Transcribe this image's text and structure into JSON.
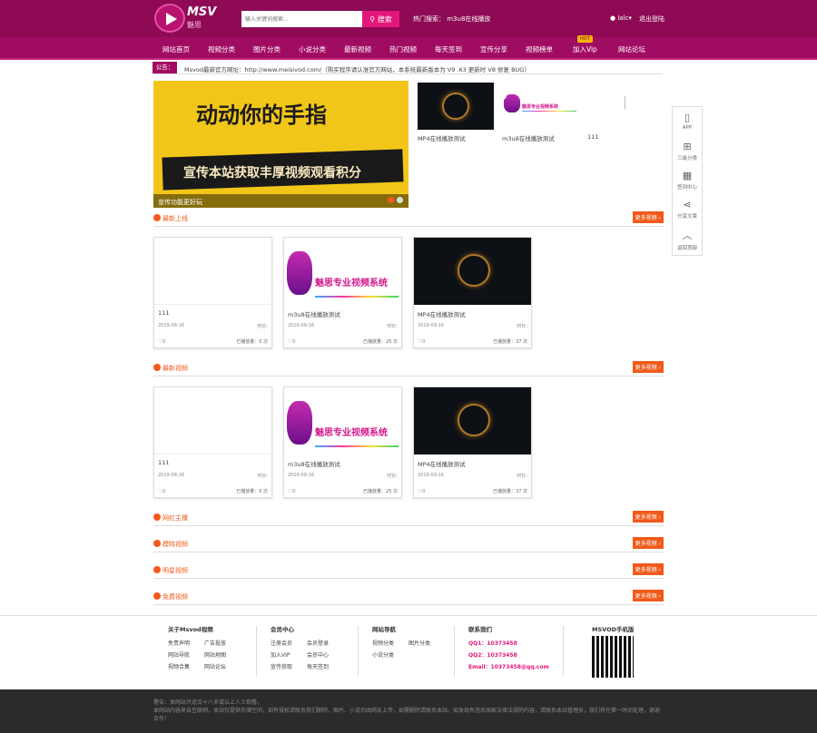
{
  "header": {
    "logo_text": "MSV",
    "logo_sub": "魅思",
    "search_placeholder": "输入关键词搜索...",
    "search_button": "搜索",
    "hot_label": "热门搜索：",
    "hot_words": "m3u8在线播放",
    "user": "lalc",
    "logout": "退出登陆"
  },
  "nav": [
    "网站首页",
    "视频分类",
    "图片分类",
    "小说分类",
    "最新视频",
    "热门视频",
    "每天签到",
    "宣传分享",
    "视频榜单",
    "加入Vip",
    "网站论坛"
  ],
  "nav_badge": "HOT",
  "notice": {
    "label": "公告：",
    "text": "Msvod最新官方网址：http://www.meisivod.com/（购买程序请认准官方网站，本系统最新版本为 V9 .63 更新时 V8 修复 BUG）"
  },
  "banner": {
    "title": "动动你的手指",
    "slogan": "宣传本站获取丰厚视频观看积分",
    "caption": "宣传功能更好玩"
  },
  "top_videos": [
    {
      "title": "MP4在线播放测试"
    },
    {
      "title": "m3u8在线播放测试"
    },
    {
      "title": "111"
    }
  ],
  "promo_text": "魅思专业视频系统",
  "sidebar": [
    "APP",
    "三级分类",
    "签到中心",
    "分享文章",
    "返回顶部"
  ],
  "sections": [
    {
      "name": "最新上线"
    },
    {
      "name": "最新视频"
    },
    {
      "name": "网红主播"
    },
    {
      "name": "模特视频"
    },
    {
      "name": "明星视频"
    },
    {
      "name": "免费视频"
    }
  ],
  "more": "更多视频",
  "cards": [
    {
      "title": "111",
      "date": "2019-08-16",
      "length": "时长:",
      "likes": "0",
      "plays": "已播放量：0 次"
    },
    {
      "title": "m3u8在线播放测试",
      "date": "2019-09-16",
      "length": "时长:",
      "likes": "0",
      "plays": "已播放量：25 次"
    },
    {
      "title": "MP4在线播放测试",
      "date": "2019-09-16",
      "length": "时长:",
      "likes": "0",
      "plays": "已播放量：37 次"
    }
  ],
  "footer": {
    "about": {
      "title": "关于Msvod视频",
      "links": [
        [
          "免责声明",
          "广告投放"
        ],
        [
          "网站导航",
          "网站地图"
        ],
        [
          "视频合集",
          "网站论坛"
        ]
      ]
    },
    "member": {
      "title": "会员中心",
      "links": [
        [
          "注册会员",
          "会员登录"
        ],
        [
          "加入VIP",
          "会员中心"
        ],
        [
          "宣传获取",
          "每天签到"
        ]
      ]
    },
    "site": {
      "title": "网站导航",
      "links": [
        [
          "视频分类",
          "图片分类"
        ],
        [
          "小说分类",
          ""
        ]
      ]
    },
    "contact": {
      "title": "联系我们",
      "qq1": "QQ1：10373458",
      "qq2": "QQ2：10373458",
      "email": "Email：10373458@qq.com"
    },
    "mobile": {
      "title": "MSVOD手机版"
    }
  },
  "bottom": {
    "line1": "警告：本网站只适合十八岁或以上人士观看。",
    "line2": "本网站内容来自互联网，本站仅提供存储空间，如有侵权请联系我们删除，图片、小说均由网友上传，如需删除请联系本站。如发现有违反国家法律法规的内容，请联系本站管理员，我们将在第一时间处理，谢谢合作！"
  }
}
